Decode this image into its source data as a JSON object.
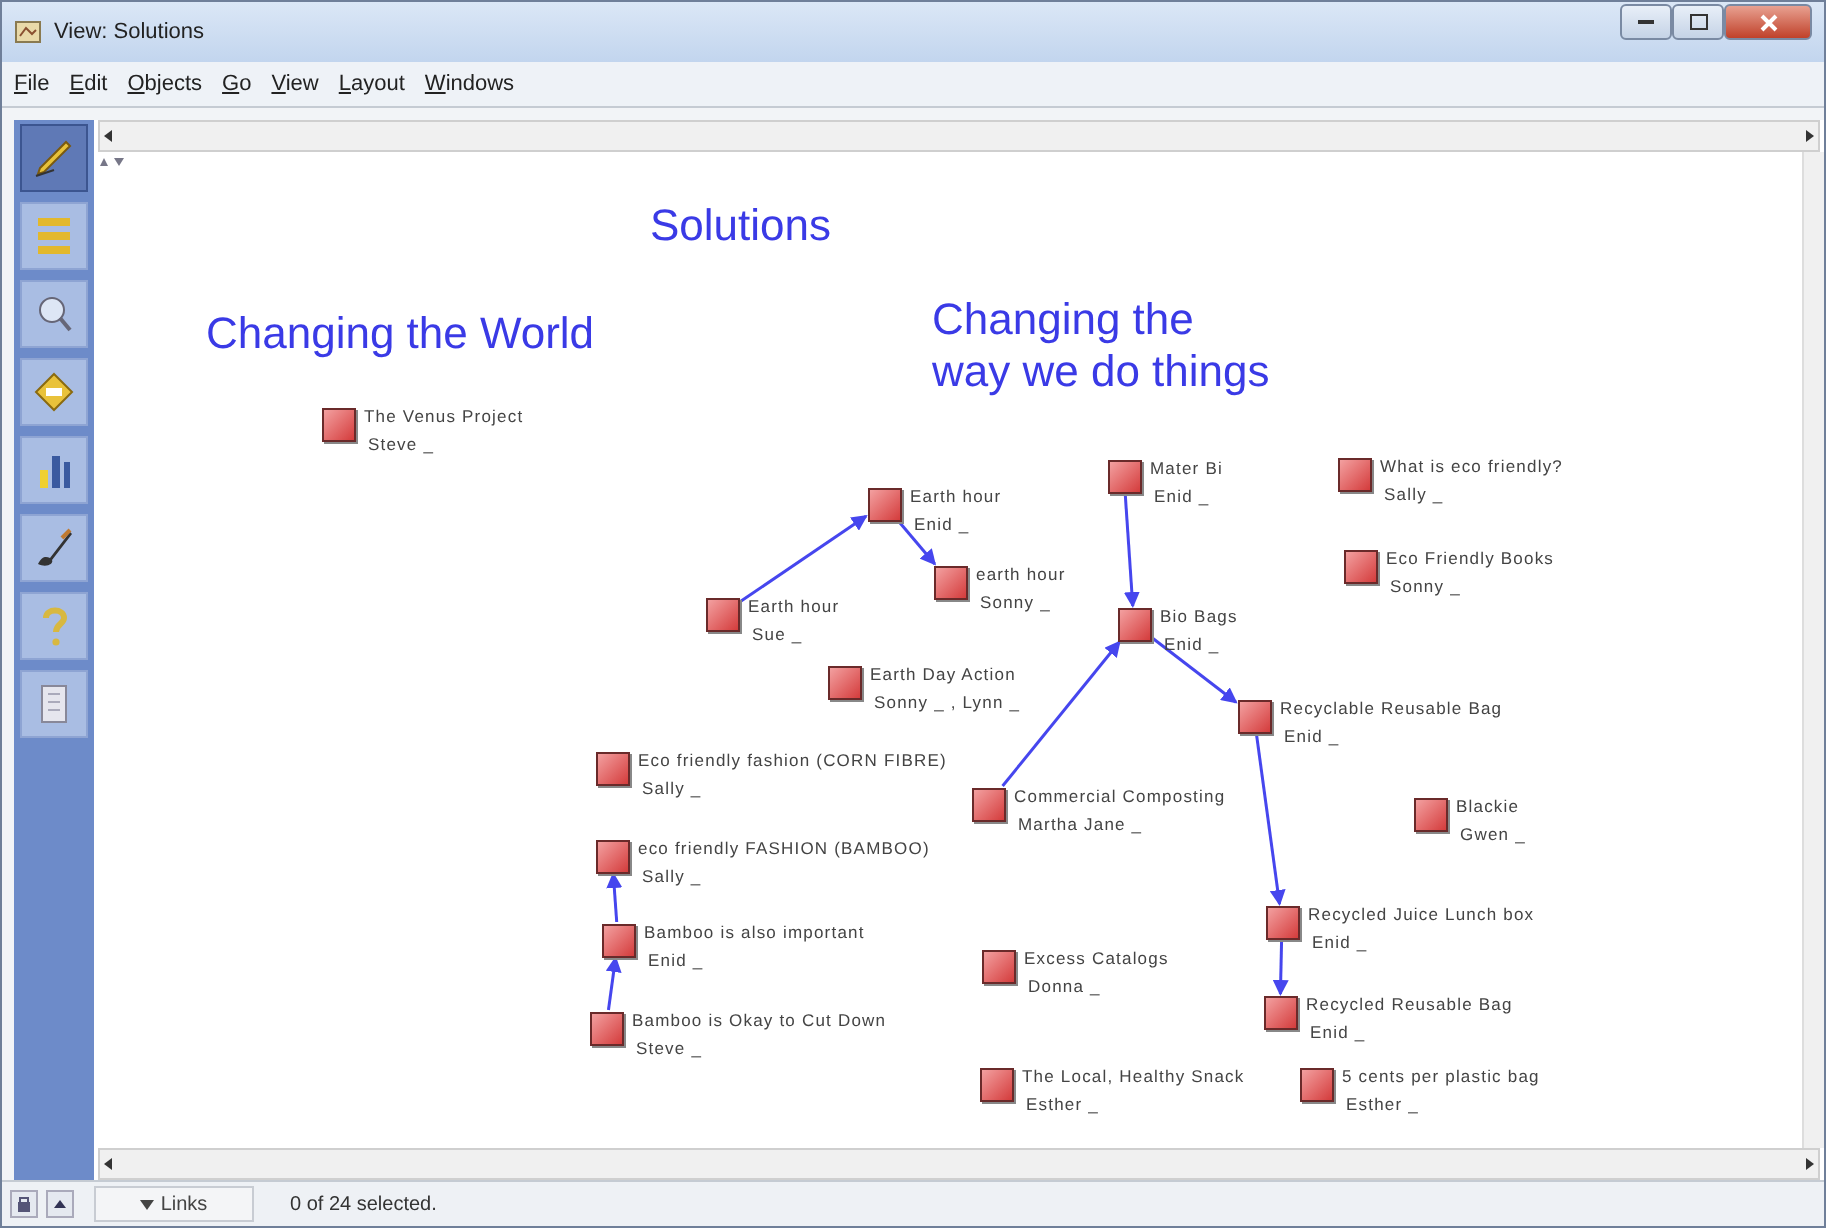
{
  "window": {
    "title": "View: Solutions"
  },
  "menu": [
    "File",
    "Edit",
    "Objects",
    "Go",
    "View",
    "Layout",
    "Windows"
  ],
  "tools": [
    {
      "kind": "pencil",
      "selected": true
    },
    {
      "kind": "list",
      "selected": false
    },
    {
      "kind": "magnifier",
      "selected": false
    },
    {
      "kind": "diamond",
      "selected": false
    },
    {
      "kind": "bars",
      "selected": false
    },
    {
      "kind": "brush",
      "selected": false
    },
    {
      "kind": "help",
      "selected": false
    },
    {
      "kind": "page",
      "selected": false
    }
  ],
  "headings": [
    "Solutions",
    "Changing the World",
    "Changing the",
    "way we do things"
  ],
  "nodes": [
    {
      "title": "The Venus Project",
      "author": "Steve _"
    },
    {
      "title": "Earth hour",
      "author": "Enid _"
    },
    {
      "title": "earth hour",
      "author": "Sonny _"
    },
    {
      "title": "Earth hour",
      "author": "Sue _"
    },
    {
      "title": "Earth Day Action",
      "author": "Sonny _ , Lynn _"
    },
    {
      "title": "Eco friendly fashion (CORN FIBRE)",
      "author": "Sally _"
    },
    {
      "title": "eco friendly FASHION (BAMBOO)",
      "author": "Sally _"
    },
    {
      "title": "Bamboo is also important",
      "author": "Enid _"
    },
    {
      "title": "Bamboo is Okay to Cut Down",
      "author": "Steve _"
    },
    {
      "title": "Mater Bi",
      "author": "Enid _"
    },
    {
      "title": "What is eco friendly?",
      "author": "Sally _"
    },
    {
      "title": "Eco Friendly Books",
      "author": "Sonny _"
    },
    {
      "title": "Bio Bags",
      "author": "Enid _"
    },
    {
      "title": "Recyclable Reusable Bag",
      "author": "Enid _"
    },
    {
      "title": "Commercial Composting",
      "author": "Martha Jane _"
    },
    {
      "title": "Blackie",
      "author": "Gwen _"
    },
    {
      "title": "Recycled Juice Lunch box",
      "author": "Enid _"
    },
    {
      "title": "Excess Catalogs",
      "author": "Donna _"
    },
    {
      "title": "Recycled Reusable Bag",
      "author": "Enid _"
    },
    {
      "title": "The Local, Healthy Snack",
      "author": "Esther _"
    },
    {
      "title": "5 cents per plastic bag",
      "author": "Esther _"
    }
  ],
  "status_bar": {
    "links_button": "Links",
    "selection": "0 of 24 selected."
  }
}
